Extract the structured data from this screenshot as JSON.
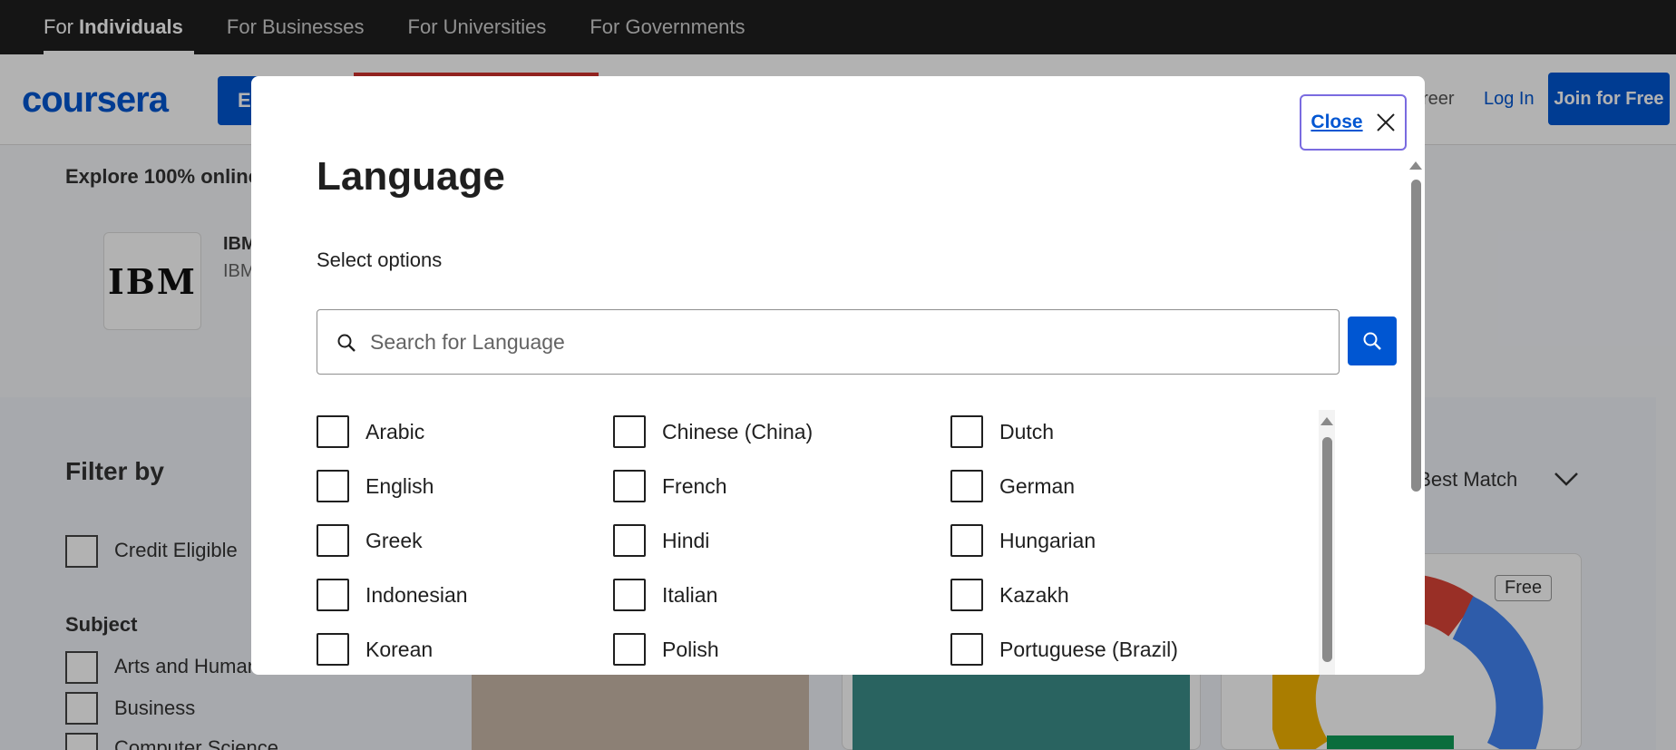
{
  "audience_tabs": [
    {
      "prefix": "For",
      "label": "Individuals"
    },
    {
      "label": "For Businesses"
    },
    {
      "label": "For Universities"
    },
    {
      "label": "For Governments"
    }
  ],
  "header": {
    "logo": "coursera",
    "explore_label": "E",
    "career_link": "reer",
    "login": "Log In",
    "join": "Join for Free"
  },
  "page": {
    "explore_text": "Explore 100% online",
    "partner_logo": "IBM",
    "partner_name": "IBM",
    "partner_sub": "IBM",
    "filter_title": "Filter by",
    "credit_eligible": "Credit Eligible",
    "subject_title": "Subject",
    "subjects": [
      "Arts and Humanities",
      "Business",
      "Computer Science"
    ],
    "sort_label": "y: Best Match",
    "free_badge": "Free"
  },
  "modal": {
    "close_label": "Close",
    "title": "Language",
    "subtitle": "Select options",
    "search_placeholder": "Search for Language",
    "options": [
      "Arabic",
      "Chinese (China)",
      "Dutch",
      "English",
      "French",
      "German",
      "Greek",
      "Hindi",
      "Hungarian",
      "Indonesian",
      "Italian",
      "Kazakh",
      "Korean",
      "Polish",
      "Portuguese (Brazil)"
    ]
  },
  "colors": {
    "brand": "#0056d2",
    "topbar": "#1f1f1f",
    "focus_ring": "#7a6be0"
  }
}
